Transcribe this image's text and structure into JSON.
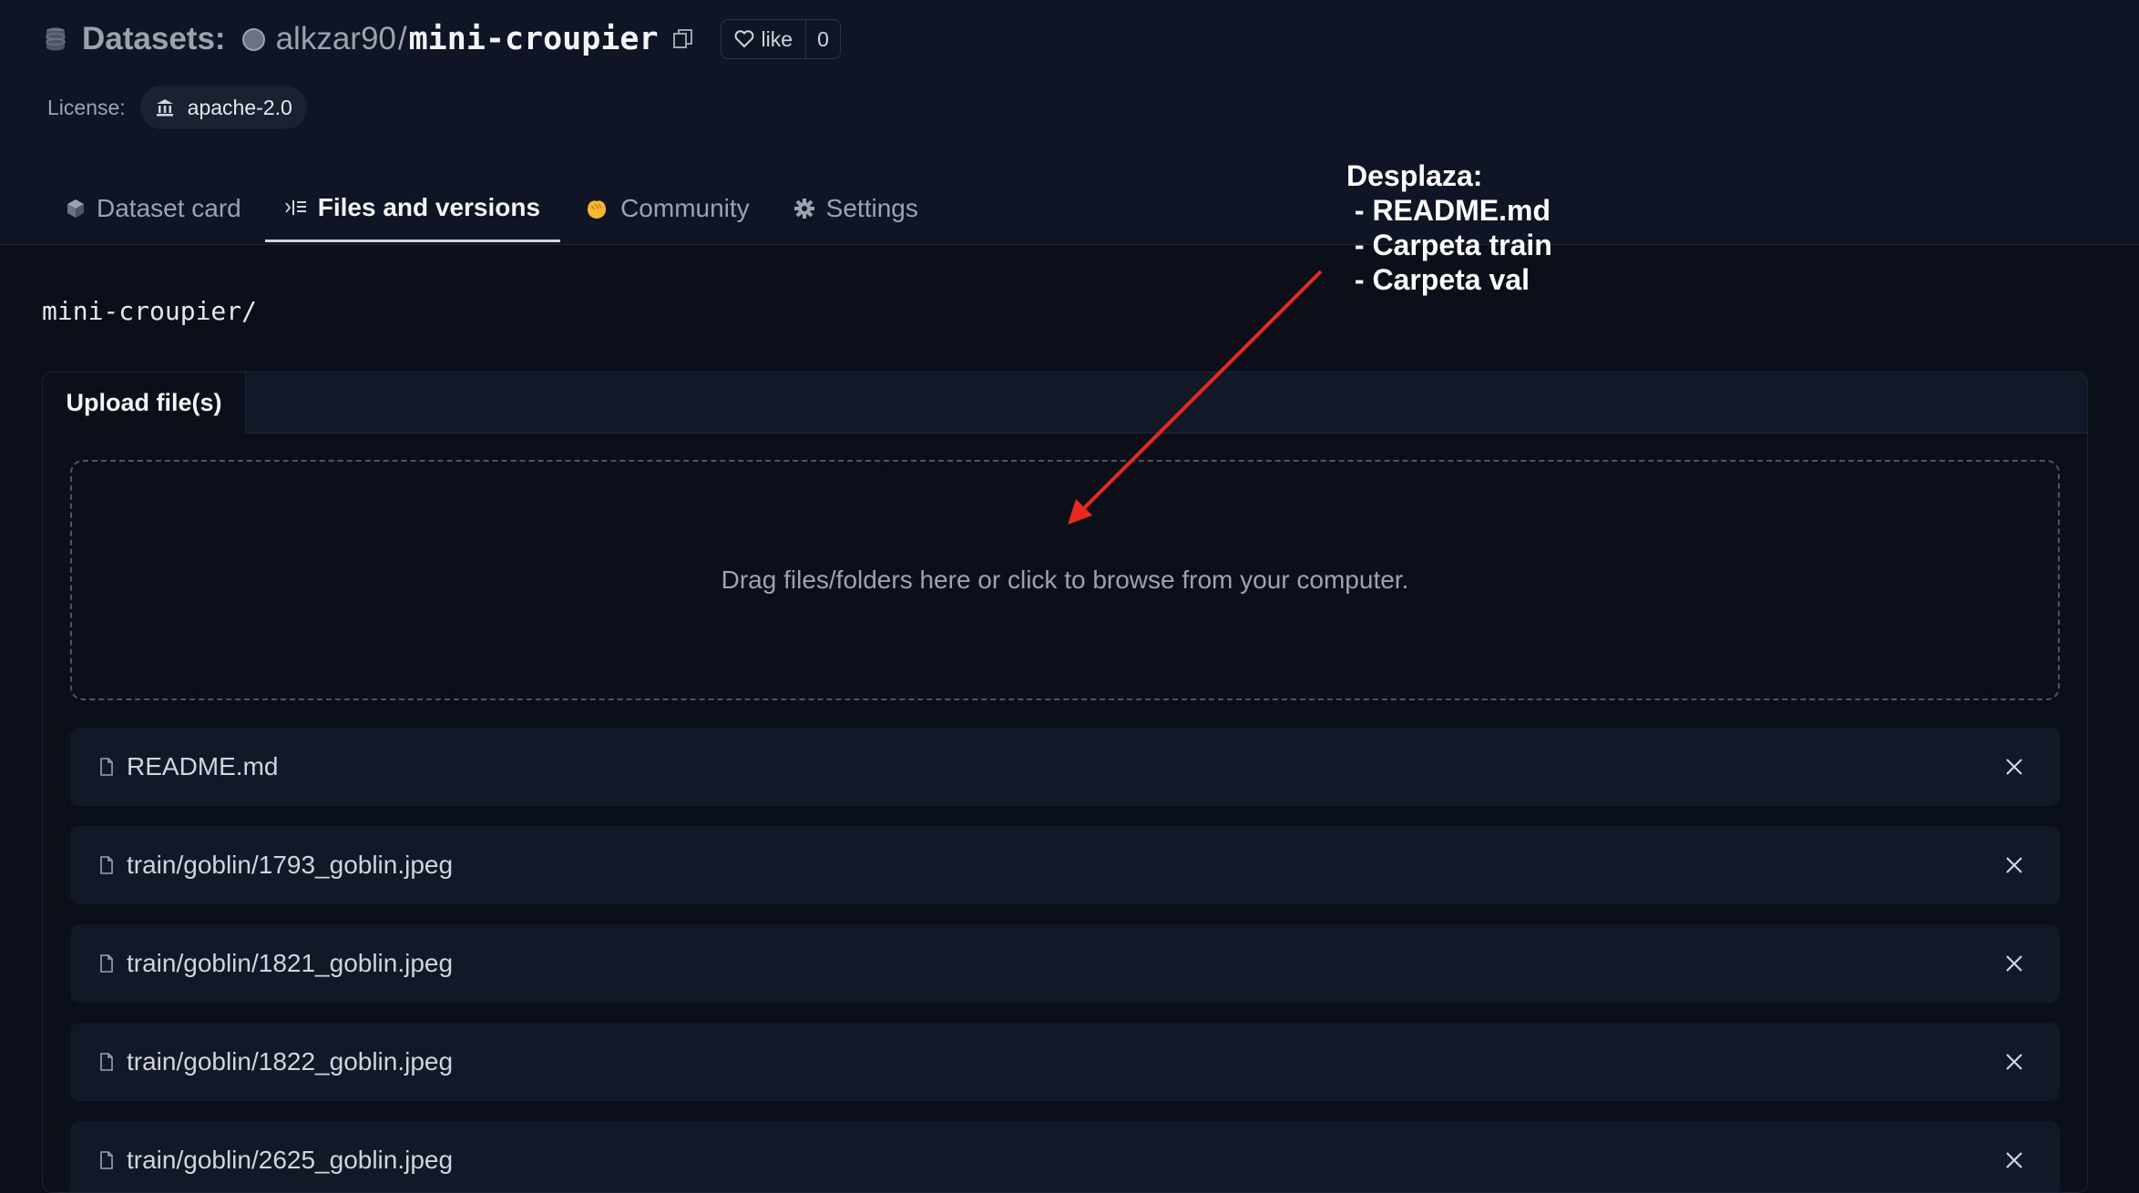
{
  "header": {
    "datasets_label": "Datasets:",
    "owner": "alkzar90",
    "slash": "/",
    "repo": "mini-croupier",
    "like_label": "like",
    "like_count": "0",
    "license_label": "License:",
    "license_value": "apache-2.0"
  },
  "tabs": [
    {
      "label": "Dataset card",
      "icon": "cube-icon",
      "active": false
    },
    {
      "label": "Files and versions",
      "icon": "files-icon",
      "active": true
    },
    {
      "label": "Community",
      "icon": "community-icon",
      "active": false
    },
    {
      "label": "Settings",
      "icon": "gear-icon",
      "active": false
    }
  ],
  "breadcrumb": "mini-croupier/",
  "upload": {
    "tab_label": "Upload file(s)",
    "dropzone_text": "Drag files/folders here or click to browse from your computer.",
    "files": [
      {
        "name": "README.md"
      },
      {
        "name": "train/goblin/1793_goblin.jpeg"
      },
      {
        "name": "train/goblin/1821_goblin.jpeg"
      },
      {
        "name": "train/goblin/1822_goblin.jpeg"
      },
      {
        "name": "train/goblin/2625_goblin.jpeg"
      }
    ]
  },
  "annotation": {
    "text": "Desplaza:\n - README.md\n - Carpeta train\n - Carpeta val",
    "arrow_color": "#e8291c"
  },
  "colors": {
    "background": "#0b0f19",
    "header": "#0f1524",
    "row": "#111827"
  }
}
